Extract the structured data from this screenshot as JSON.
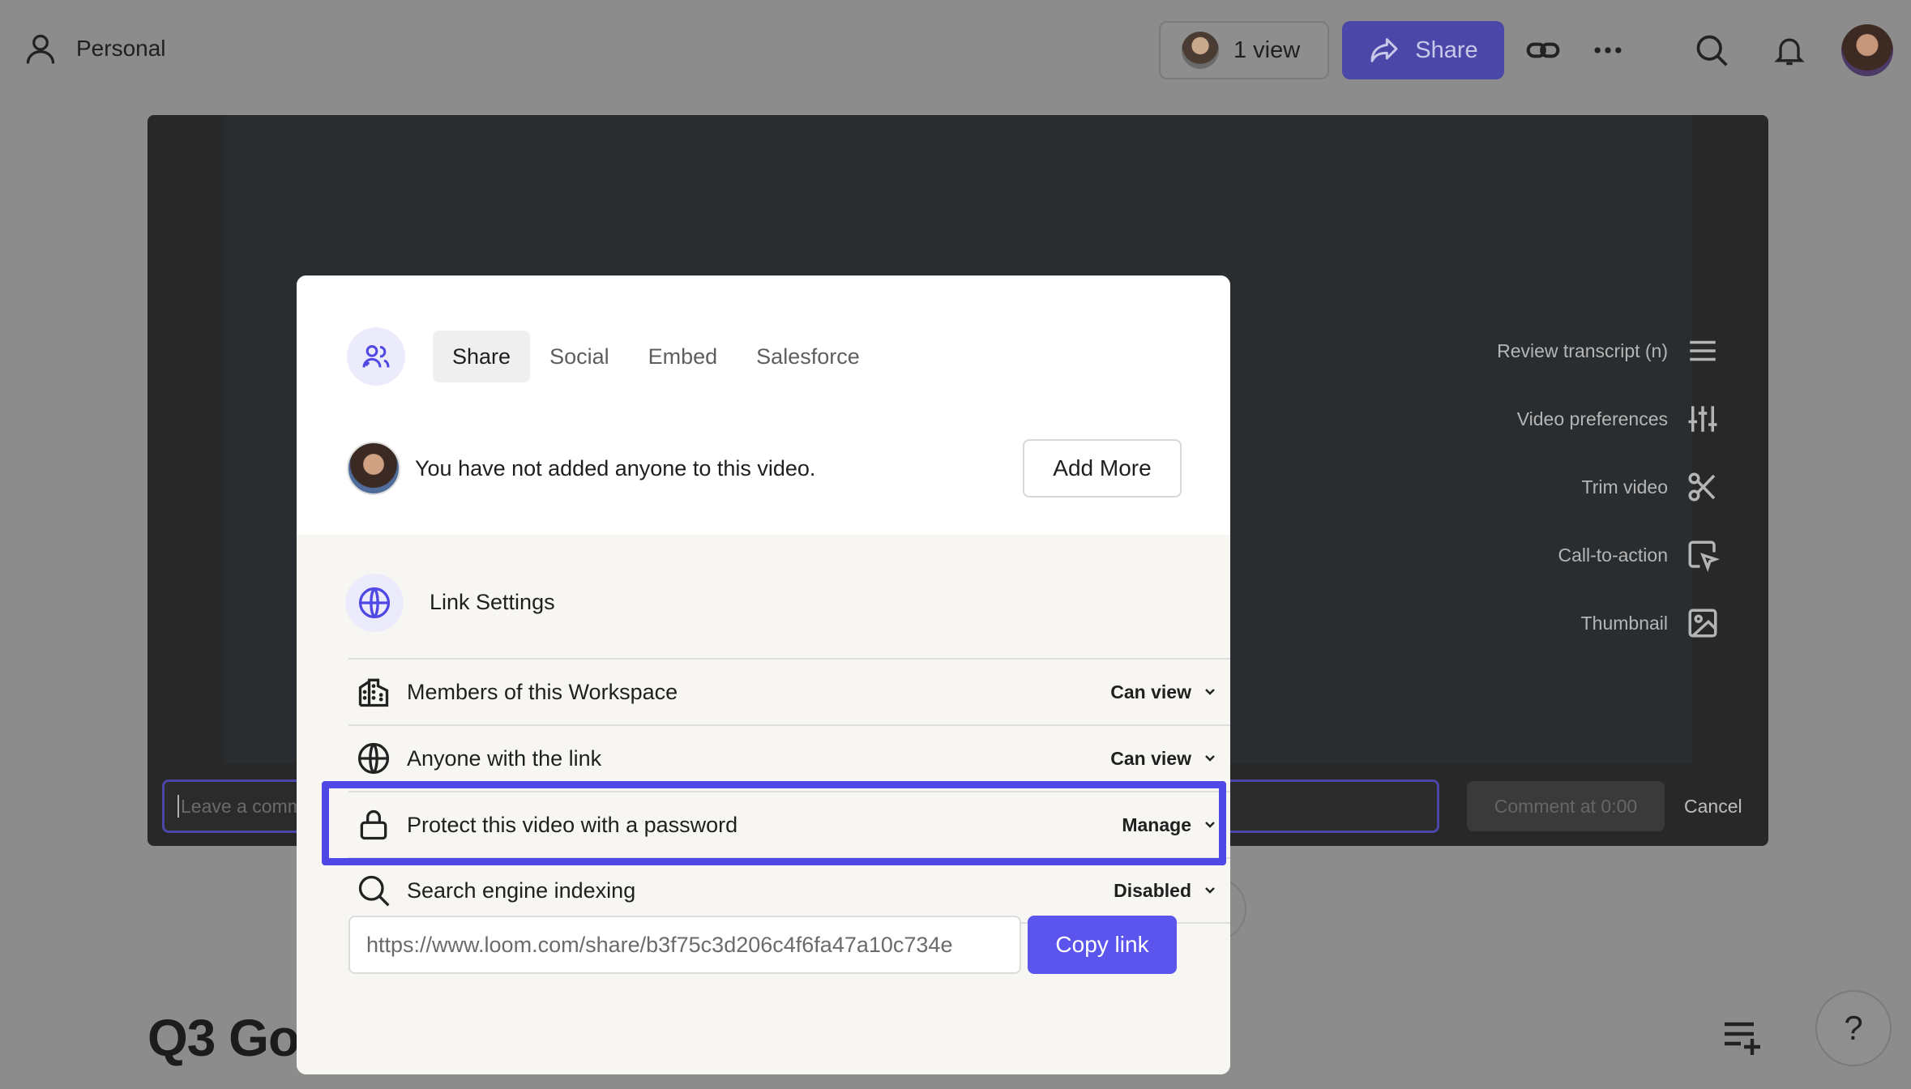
{
  "topbar": {
    "workspace_label": "Personal",
    "views_label": "1 view",
    "share_label": "Share",
    "icons": [
      "user-icon",
      "link-icon",
      "more-icon",
      "search-icon",
      "bell-icon"
    ]
  },
  "video": {
    "tools": [
      {
        "label": "Review transcript (n)",
        "icon": "transcript-icon"
      },
      {
        "label": "Video preferences",
        "icon": "sliders-icon"
      },
      {
        "label": "Trim video",
        "icon": "scissors-icon"
      },
      {
        "label": "Call-to-action",
        "icon": "cursor-click-icon"
      },
      {
        "label": "Thumbnail",
        "icon": "image-icon"
      }
    ],
    "comment_placeholder": "Leave a comm",
    "comment_button": "Comment at 0:00",
    "cancel_button": "Cancel"
  },
  "page": {
    "title": "Q3 Go",
    "help_label": "?"
  },
  "modal": {
    "tabs": [
      {
        "label": "Share",
        "active": true
      },
      {
        "label": "Social",
        "active": false
      },
      {
        "label": "Embed",
        "active": false
      },
      {
        "label": "Salesforce",
        "active": false
      }
    ],
    "people_text": "You have not added anyone to this video.",
    "add_more_label": "Add More",
    "link_settings_title": "Link Settings",
    "rows": [
      {
        "label": "Members of this Workspace",
        "value": "Can view",
        "icon": "building-icon"
      },
      {
        "label": "Anyone with the link",
        "value": "Can view",
        "icon": "globe-icon"
      },
      {
        "label": "Protect this video with a password",
        "value": "Manage",
        "icon": "lock-icon"
      },
      {
        "label": "Search engine indexing",
        "value": "Disabled",
        "icon": "search-icon"
      }
    ],
    "url_value": "https://www.loom.com/share/b3f75c3d206c4f6fa47a10c734e",
    "copy_label": "Copy link"
  },
  "colors": {
    "accent": "#5b55ee",
    "highlight": "#5048e5",
    "overlay": "#8c8c8c"
  }
}
